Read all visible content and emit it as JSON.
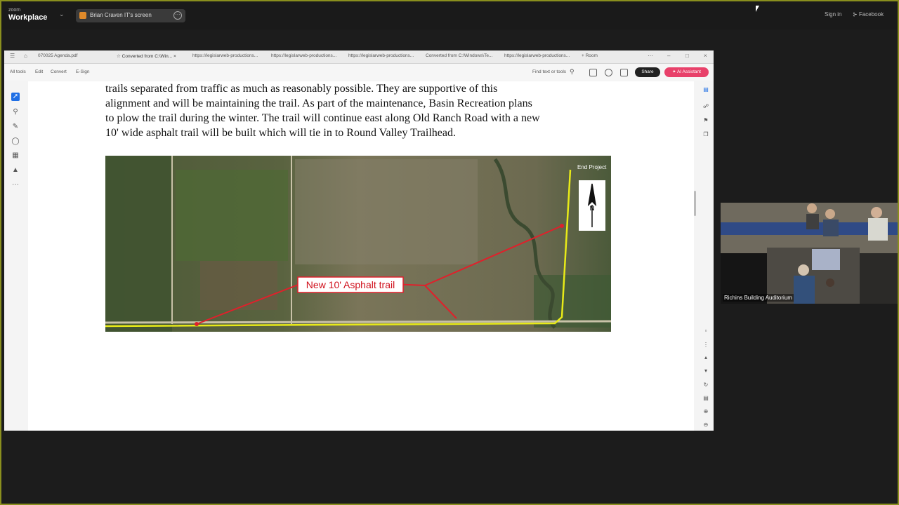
{
  "zoom": {
    "logo_top": "zoom",
    "logo_bottom": "Workplace",
    "share_label": "Brian Craven   IT's screen",
    "signin": "Sign in",
    "facebook": "Facebook",
    "accent": "#8a8f1e"
  },
  "browser": {
    "tabs": [
      "070025 Agenda.pdf",
      "Converted from C:\\Win...",
      "https://legislarweb-productions...",
      "https://legislarweb-productions...",
      "https://legislarweb-productions...",
      "Converted from C:\\Windows\\Te...",
      "https://legislarweb-productions...",
      "+ Room"
    ],
    "toolbar": [
      "All tools",
      "Edit",
      "Convert",
      "E-Sign"
    ],
    "find_placeholder": "Find text or tools",
    "share_btn": "Share",
    "ai_btn": "AI Assistant",
    "ai_color": "#e8416a"
  },
  "document": {
    "lines": [
      "trails separated from traffic as much as reasonably possible.  They are supportive of this",
      "alignment and will be maintaining the trail.  As part of the maintenance, Basin Recreation plans",
      "to plow the trail during the winter.  The trail will continue east along Old Ranch Road with a new",
      "10' wide asphalt trail will be built which will tie in to Round Valley Trailhead."
    ],
    "map_label": "New 10' Asphalt trail",
    "map_end_label": "End Project",
    "north_label": "N"
  },
  "video": {
    "name": "Richins Building Auditorium"
  }
}
